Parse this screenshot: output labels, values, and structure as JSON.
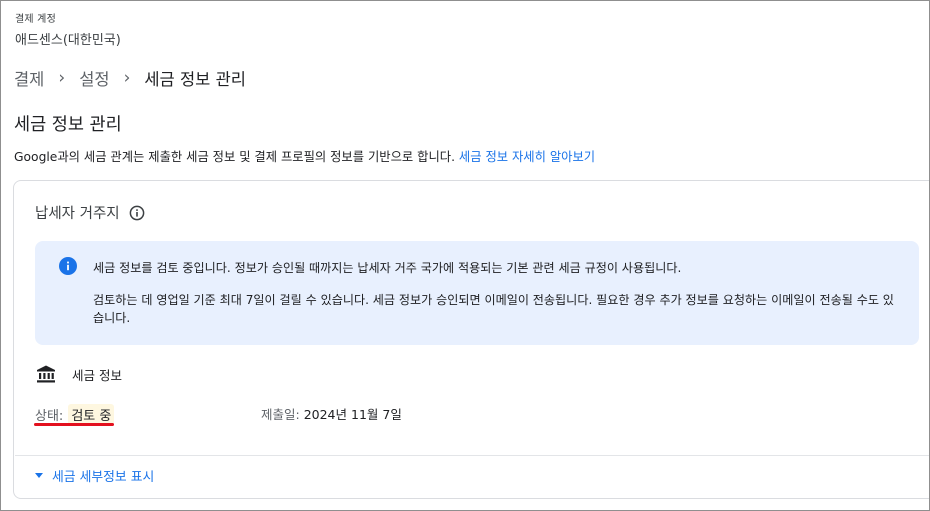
{
  "account": {
    "caption": "결제 계정",
    "name": "애드센스(대한민국)"
  },
  "breadcrumb": {
    "items": [
      {
        "label": "결제"
      },
      {
        "label": "설정"
      },
      {
        "label": "세금 정보 관리"
      }
    ],
    "separator": "›"
  },
  "page": {
    "title": "세금 정보 관리",
    "description": "Google과의 세금 관계는 제출한 세금 정보 및 결제 프로필의 정보를 기반으로 합니다.",
    "learn_more_link": "세금 정보 자세히 알아보기"
  },
  "residency": {
    "title": "납세자 거주지"
  },
  "notice": {
    "line1": "세금 정보를 검토 중입니다. 정보가 승인될 때까지는 납세자 거주 국가에 적용되는 기본 관련 세금 규정이 사용됩니다.",
    "line2": "검토하는 데 영업일 기준 최대 7일이 걸릴 수 있습니다. 세금 정보가 승인되면 이메일이 전송됩니다. 필요한 경우 추가 정보를 요청하는 이메일이 전송될 수도 있습니다."
  },
  "tax_info": {
    "label": "세금 정보",
    "status_label": "상태:",
    "status_value": "검토 중",
    "submitted_label": "제출일:",
    "submitted_value": "2024년 11월 7일"
  },
  "details": {
    "toggle_label": "세금 세부정보 표시"
  },
  "colors": {
    "link": "#1a73e8",
    "notice_bg": "#e8f0fe",
    "status_badge_bg": "#fef7e0",
    "status_underline": "#e3101e"
  },
  "icons": {
    "residency_info": "info-outline-icon",
    "notice": "info-filled-icon",
    "tax_info": "bank-icon",
    "toggle": "caret-down-icon"
  }
}
